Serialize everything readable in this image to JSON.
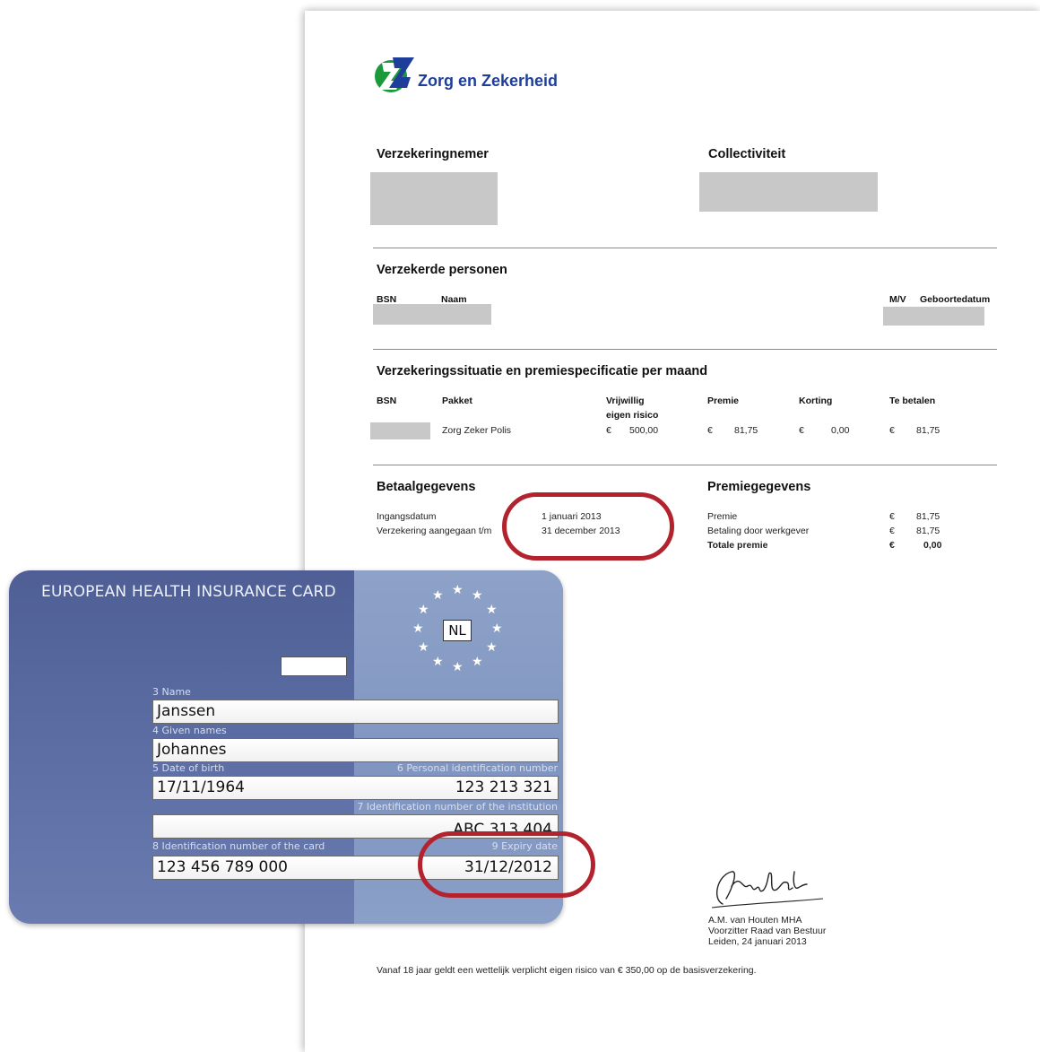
{
  "policy": {
    "logo_text": "Zorg en Zekerheid",
    "logo_mark": "ZZ",
    "colors": {
      "logo_green": "#1a9a3a",
      "logo_blue": "#1f3e99",
      "highlight": "#b3232e"
    },
    "sections": {
      "policyholder": "Verzekeringnemer",
      "collective": "Collectiviteit",
      "insured_persons": "Verzekerde personen",
      "insurance_situation": "Verzekeringssituatie en premiespecificatie per maand",
      "payment": "Betaalgegevens",
      "premium": "Premiegegevens"
    },
    "persons_headers": {
      "bsn": "BSN",
      "name": "Naam",
      "gender": "M/V",
      "birthdate": "Geboortedatum"
    },
    "situation_headers": {
      "bsn": "BSN",
      "package": "Pakket",
      "voluntary_1": "Vrijwillig",
      "voluntary_2": "eigen risico",
      "premium": "Premie",
      "discount": "Korting",
      "to_pay": "Te betalen"
    },
    "situation_row": {
      "package": "Zorg Zeker Polis",
      "voluntary_cur": "€",
      "voluntary": "500,00",
      "premium_cur": "€",
      "premium": "81,75",
      "discount_cur": "€",
      "discount": "0,00",
      "to_pay_cur": "€",
      "to_pay": "81,75"
    },
    "payment": {
      "start_label": "Ingangsdatum",
      "start_value": "1 januari 2013",
      "end_label": "Verzekering aangegaan t/m",
      "end_value": "31 december 2013"
    },
    "premium_details": {
      "premium_label": "Premie",
      "premium_cur": "€",
      "premium_value": "81,75",
      "employer_label": "Betaling door werkgever",
      "employer_cur": "€",
      "employer_value": "81,75",
      "total_label": "Totale premie",
      "total_cur": "€",
      "total_value": "0,00"
    },
    "signatory": {
      "name": "A.M. van Houten MHA",
      "role": "Voorzitter Raad van Bestuur",
      "place_date": "Leiden, 24 januari 2013"
    },
    "footer_note": "Vanaf 18 jaar geldt een wettelijk verplicht eigen risico van € 350,00 op de basisverzekering."
  },
  "card": {
    "title": "EUROPEAN HEALTH INSURANCE CARD",
    "country": "NL",
    "labels": {
      "name": "3 Name",
      "given_names": "4 Given names",
      "dob": "5 Date of birth",
      "personal_id": "6 Personal identification number",
      "institution_id": "7 Identification number of the institution",
      "card_id": "8 Identification number of the card",
      "expiry": "9 Expiry date"
    },
    "values": {
      "name": "Janssen",
      "given_names": "Johannes",
      "dob": "17/11/1964",
      "personal_id": "123 213 321",
      "institution_id": "ABC 313 404",
      "card_id": "123 456 789 000",
      "expiry": "31/12/2012"
    },
    "colors": {
      "card_blue": "#5a6ca2",
      "card_light": "#8ea2c8"
    }
  }
}
